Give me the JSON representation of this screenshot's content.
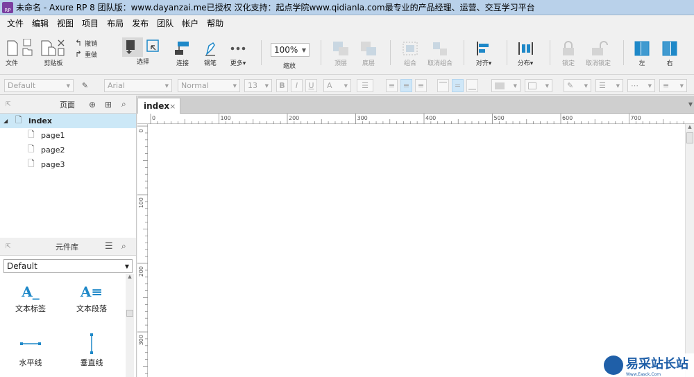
{
  "window": {
    "app_icon_text": "RP",
    "title": "未命名 - Axure RP 8 团队版：www.dayanzai.me已授权 汉化支持：起点学院www.qidianla.com最专业的产品经理、运营、交互学习平台"
  },
  "menu": [
    "文件",
    "编辑",
    "视图",
    "项目",
    "布局",
    "发布",
    "团队",
    "帐户",
    "帮助"
  ],
  "toolbar": {
    "file_label": "文件",
    "clipboard_label": "剪贴板",
    "undo_label": "撤销",
    "redo_label": "重做",
    "select_label": "选择",
    "connect_label": "连接",
    "pen_label": "钢笔",
    "more_label": "更多▾",
    "zoom_value": "100%",
    "zoom_label": "缩放",
    "top_label": "顶层",
    "bottom_label": "底层",
    "group_label": "组合",
    "ungroup_label": "取消组合",
    "align_label": "对齐▾",
    "distribute_label": "分布▾",
    "lock_label": "锁定",
    "unlock_label": "取消锁定",
    "left_label": "左",
    "right_label": "右"
  },
  "format": {
    "style_value": "Default",
    "font_value": "Arial",
    "weight_value": "Normal",
    "size_value": "13",
    "bold": "B",
    "italic": "I",
    "underline": "U",
    "text_color": "A"
  },
  "pages_panel": {
    "title": "页面",
    "root": "index",
    "children": [
      "page1",
      "page2",
      "page3"
    ]
  },
  "library_panel": {
    "title": "元件库",
    "selected_library": "Default",
    "widgets": [
      "文本标签",
      "文本段落",
      "水平线",
      "垂直线"
    ]
  },
  "canvas": {
    "tab_label": "index",
    "ruler_h": [
      "0",
      "100",
      "200",
      "300",
      "400",
      "500",
      "600",
      "700"
    ],
    "ruler_v": [
      "0",
      "100",
      "200",
      "300"
    ]
  },
  "watermark": {
    "text": "易采站长站",
    "sub": "Www.Easck.Com"
  },
  "colors": {
    "titlebar": "#b9d1ea",
    "accent_blue": "#1e88c8",
    "selected_row": "#cce8f7"
  }
}
